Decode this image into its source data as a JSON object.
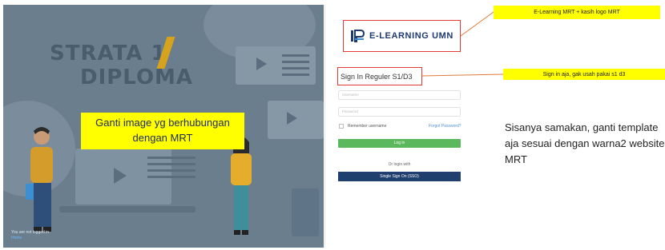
{
  "hero": {
    "title_line1": "STRATA 1",
    "title_line2": "DIPLOMA",
    "annotation": "Ganti image yg berhubungan dengan MRT",
    "not_logged_in": "You are not logged in.",
    "home_link": "Home"
  },
  "login_panel": {
    "logo_text": "E-LEARNING UMN",
    "heading": "Sign In Reguler S1/D3",
    "username_placeholder": "Username",
    "password_placeholder": "Password",
    "remember_label": "Remember username",
    "forgot_label": "Forgot Password?",
    "login_button": "Log in",
    "or_login_with": "Or login with",
    "sso_button": "Single Sign On (SSO)"
  },
  "notes": {
    "logo_note": "E-Learning MRT + kasih logo MRT",
    "signin_note": "Sign in aja, gak usah pakai s1 d3",
    "side_note": "Sisanya samakan, ganti template aja sesuai dengan warna2 website MRT"
  },
  "colors": {
    "hero_bg": "#6a7e8e",
    "login_green": "#5cb85c",
    "sso_navy": "#1f3f6e",
    "highlight_yellow": "#ffff00",
    "annotation_red": "#e53935"
  }
}
